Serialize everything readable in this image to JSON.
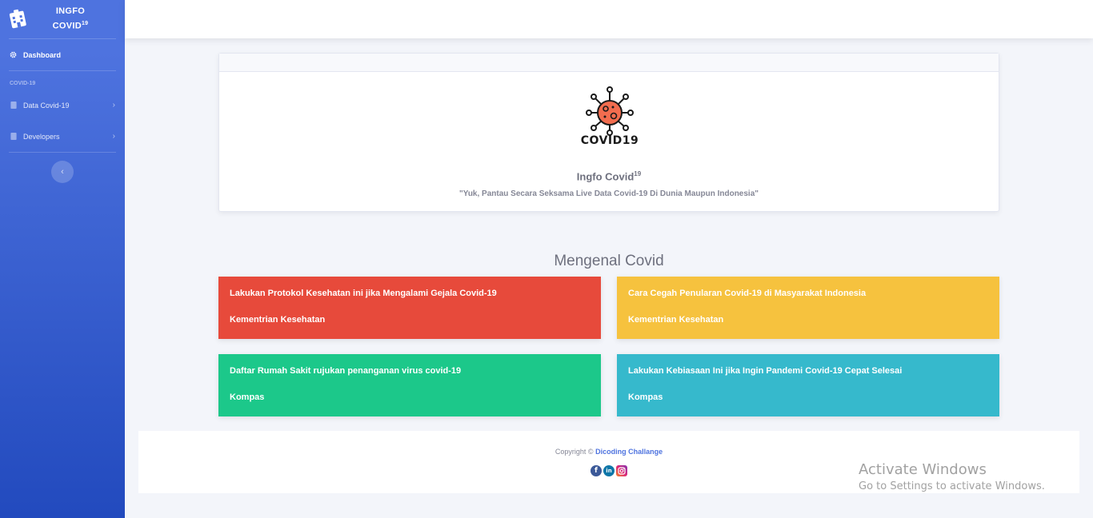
{
  "sidebar": {
    "brand_line1": "INGFO",
    "brand_line2": "COVID",
    "brand_sup": "19",
    "dashboard_label": "Dashboard",
    "section_heading": "COVID-19",
    "items": [
      {
        "label": "Data Covid-19",
        "icon": "file-icon"
      },
      {
        "label": "Developers",
        "icon": "file-icon"
      }
    ],
    "toggle_icon": "chevron-left-icon"
  },
  "hero": {
    "logo_text": "COVID19",
    "title": "Ingfo Covid",
    "title_sup": "19",
    "quote": "\"Yuk, Pantau Secara Seksama Live Data Covid-19 Di Dunia Maupun Indonesia\""
  },
  "section_title": "Mengenal Covid",
  "cards": [
    {
      "title": "Lakukan Protokol Kesehatan ini jika Mengalami Gejala Covid-19",
      "source": "Kementrian Kesehatan",
      "color": "#e74a3b"
    },
    {
      "title": "Cara Cegah Penularan Covid-19 di Masyarakat Indonesia",
      "source": "Kementrian Kesehatan",
      "color": "#f6c23e"
    },
    {
      "title": "Daftar Rumah Sakit rujukan penanganan virus covid-19",
      "source": "Kompas",
      "color": "#1cc88a"
    },
    {
      "title": "Lakukan Kebiasaan Ini jika Ingin Pandemi Covid-19 Cepat Selesai",
      "source": "Kompas",
      "color": "#36b9cc"
    }
  ],
  "footer": {
    "copyright_prefix": "Copyright ©",
    "copyright_link": "Dicoding Challange",
    "socials": [
      "facebook-icon",
      "linkedin-icon",
      "instagram-icon"
    ],
    "facebook_glyph": "f",
    "linkedin_glyph": "in"
  },
  "watermark": {
    "line1": "Activate Windows",
    "line2": "Go to Settings to activate Windows."
  },
  "colors": {
    "primary": "#4e73df",
    "danger": "#e74a3b",
    "warning": "#f6c23e",
    "success": "#1cc88a",
    "info": "#36b9cc"
  }
}
